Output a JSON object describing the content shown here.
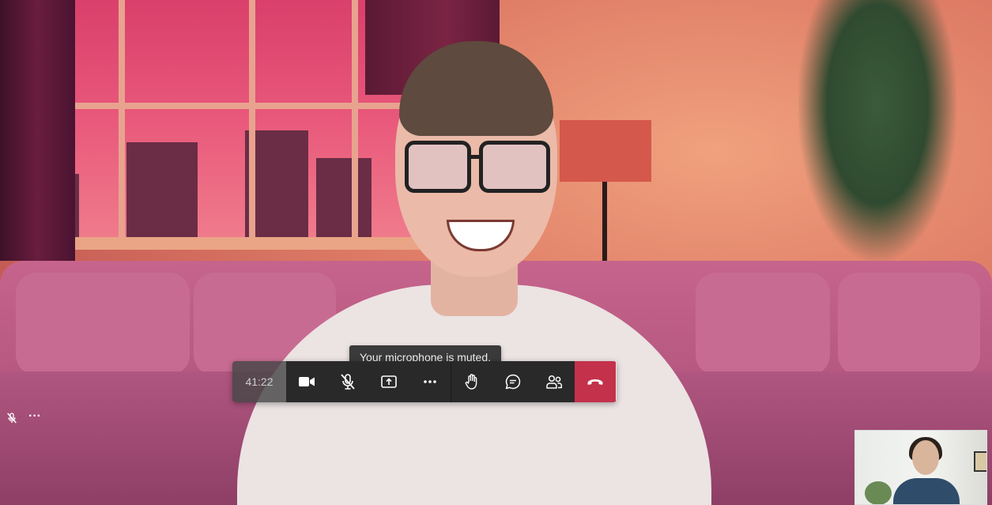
{
  "call": {
    "elapsed": "41:22",
    "tooltip": "Your microphone is muted."
  },
  "toolbar": {
    "buttons": [
      {
        "id": "camera",
        "icon": "video-camera-icon"
      },
      {
        "id": "mic",
        "icon": "microphone-muted-icon",
        "state": "muted"
      },
      {
        "id": "share",
        "icon": "share-screen-icon"
      },
      {
        "id": "more",
        "icon": "more-actions-icon"
      },
      {
        "id": "raise-hand",
        "icon": "raise-hand-icon"
      },
      {
        "id": "chat",
        "icon": "chat-icon"
      },
      {
        "id": "participants",
        "icon": "participants-icon"
      },
      {
        "id": "hang-up",
        "icon": "hang-up-icon"
      }
    ]
  },
  "self_view": {
    "more_label": "···",
    "mic_state": "muted"
  },
  "colors": {
    "hangup": "#c4314b",
    "toolbar_bg": "#292929",
    "tooltip_bg": "#3a3a3a"
  }
}
